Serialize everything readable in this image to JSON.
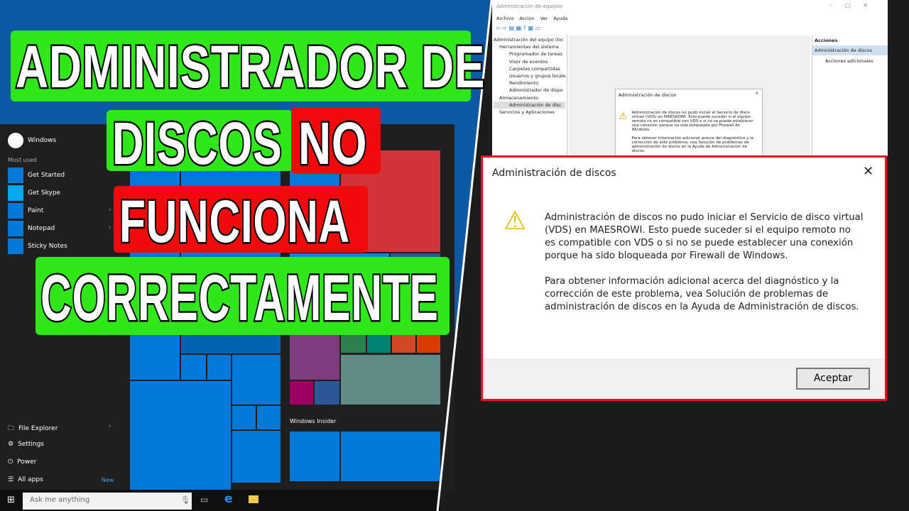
{
  "headline": {
    "line1": "ADMINISTRADOR  DE",
    "line2a": "DISCOS",
    "line2b": "NO",
    "line3": "FUNCIONA",
    "line4": "CORRECTAMENTE",
    "green": "#2ee81a",
    "red": "#f00a0a"
  },
  "start_menu": {
    "user": "Windows",
    "most_used_label": "Most used",
    "apps": [
      "Get Started",
      "Get Skype",
      "Paint",
      "Notepad",
      "Sticky Notes"
    ],
    "bottom": {
      "file_explorer": "File Explorer",
      "settings": "Settings",
      "power": "Power",
      "all_apps": "All apps",
      "new_badge": "New"
    },
    "group_label": "Windows Insider"
  },
  "taskbar": {
    "search_placeholder": "Ask me anything"
  },
  "mmc": {
    "title": "Administración de equipos",
    "menu": [
      "Archivo",
      "Acción",
      "Ver",
      "Ayuda"
    ],
    "tree": [
      "Administración del equipo (loc",
      "Herramientas del sistema",
      "Programador de tareas",
      "Visor de eventos",
      "Carpetas compartidas",
      "Usuarios y grupos locale",
      "Rendimiento",
      "Administrador de dispo",
      "Almacenamiento",
      "Administración de disc",
      "Servicios y Aplicaciones"
    ],
    "actions": {
      "header": "Acciones",
      "selected": "Administración de discos",
      "more": "Acciones adicionales"
    }
  },
  "dialog": {
    "title": "Administración de discos",
    "message1": "Administración de discos no pudo iniciar el Servicio de disco virtual (VDS) en MAESROWI. Esto puede suceder si el equipo remoto no es compatible con VDS o si no se puede establecer una conexión porque ha sido bloqueada por Firewall de Windows.",
    "message2": "Para obtener información adicional acerca del diagnóstico y la corrección de este problema, vea Solución de problemas de administración de discos en la Ayuda de Administración de discos.",
    "ok": "Aceptar",
    "close": "✕"
  }
}
